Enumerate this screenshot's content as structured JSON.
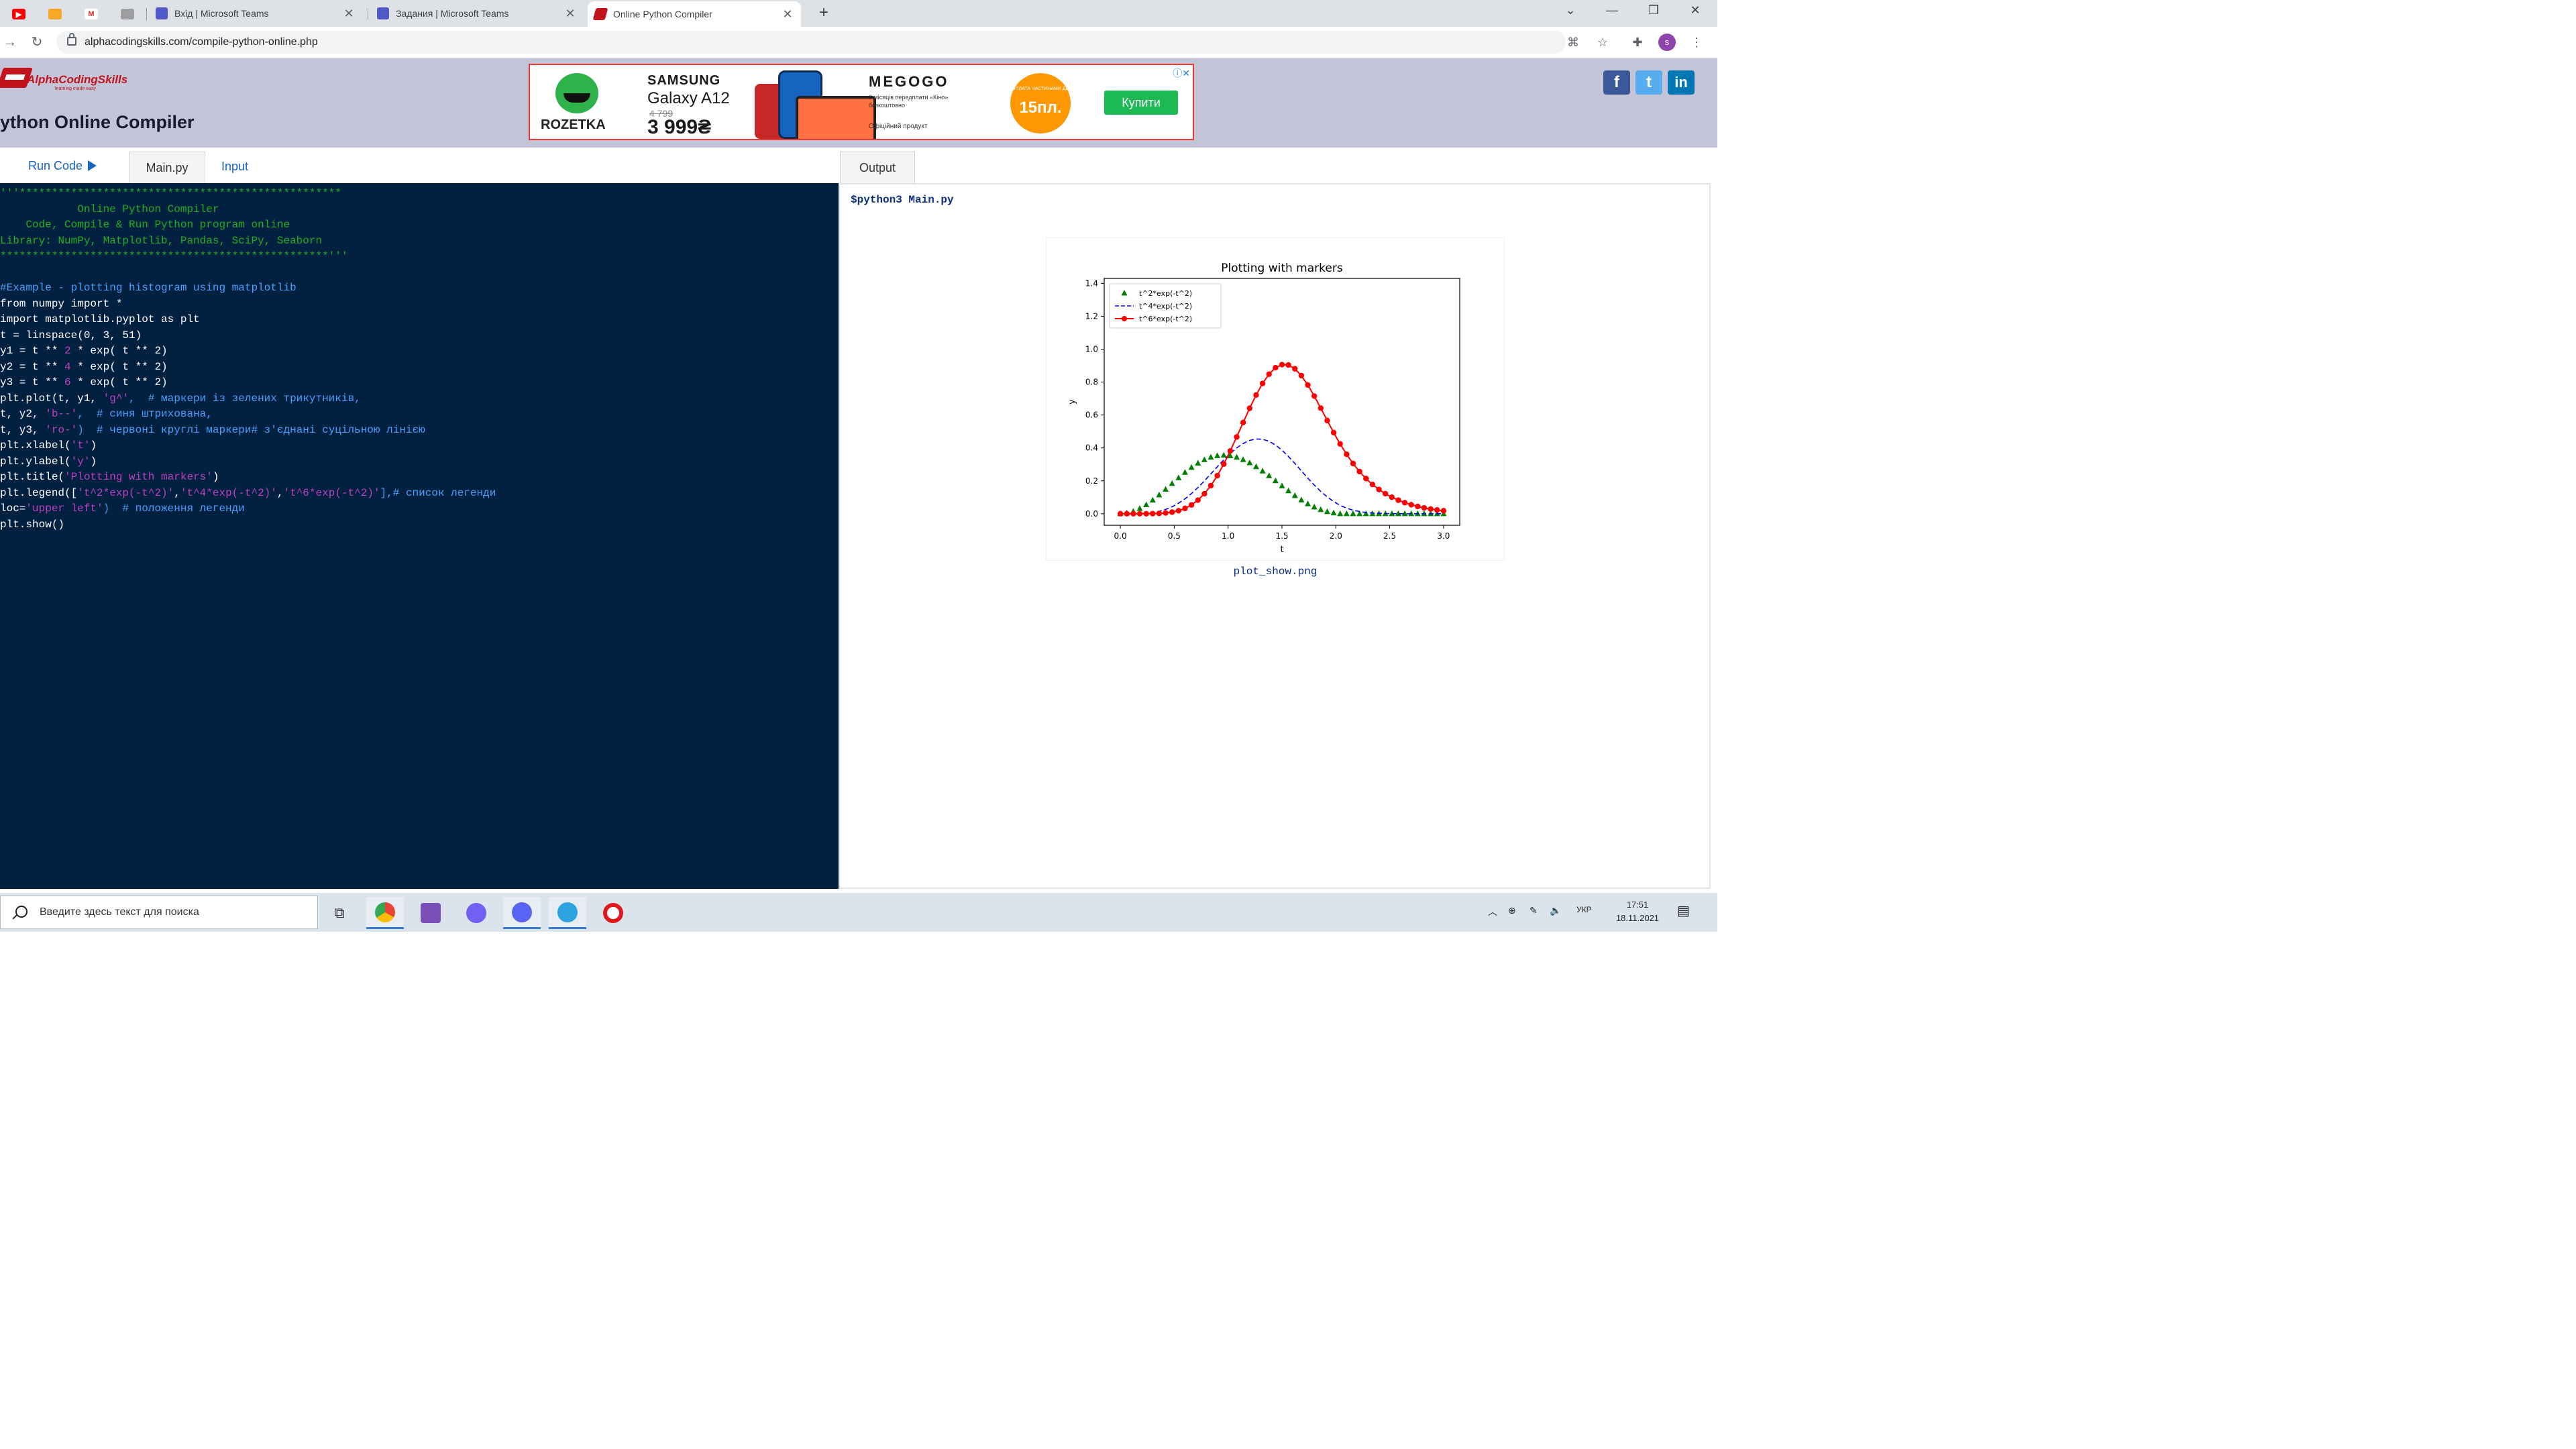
{
  "browser": {
    "tabs": [
      {
        "title": "Вхід | Microsoft Teams"
      },
      {
        "title": "Задания | Microsoft Teams"
      },
      {
        "title": "Online Python Compiler"
      }
    ],
    "new_tab": "+",
    "url": "alphacodingskills.com/compile-python-online.php",
    "profile_initial": "s",
    "pinned_labels": {
      "gmail": "M"
    }
  },
  "site": {
    "logo_text": "AlphaCodingSkills",
    "logo_sub": "learning made easy",
    "title": "ython Online Compiler",
    "social": {
      "facebook": "f",
      "twitter": "t",
      "linkedin": "in"
    }
  },
  "ad": {
    "rozetka": "ROZETKA",
    "brand": "SAMSUNG",
    "model": "Galaxy A12",
    "old_price": "4 799",
    "price": "3 999₴",
    "service": "MEGOGO",
    "service_desc": "6 місяців передплати «Кіно» безкоштовно",
    "official": "Офіційний продукт",
    "badge_top": "ОПЛАТА ЧАСТИНАМИ ДО",
    "badge_num": "15пл.",
    "buy": "Купити",
    "close": "ⓘ✕"
  },
  "editor": {
    "run_label": "Run Code",
    "tab_main": "Main.py",
    "tab_input": "Input",
    "lines": [
      [
        {
          "t": "'''**************************************************",
          "c": "cm"
        }
      ],
      [
        {
          "t": "            Online Python Compiler",
          "c": "cm"
        }
      ],
      [
        {
          "t": "    Code, Compile & Run Python program online",
          "c": "cm"
        }
      ],
      [
        {
          "t": "Library: NumPy, Matplotlib, Pandas, SciPy, Seaborn",
          "c": "cm"
        }
      ],
      [
        {
          "t": "***************************************************'''",
          "c": "cm"
        }
      ],
      [
        {
          "t": "",
          "c": "pl"
        }
      ],
      [
        {
          "t": "#Example - plotting histogram using matplotlib",
          "c": "fn"
        }
      ],
      [
        {
          "t": "from numpy import *",
          "c": "pl"
        }
      ],
      [
        {
          "t": "import matplotlib.pyplot as plt",
          "c": "pl"
        }
      ],
      [
        {
          "t": "t = linspace(0, 3, 51)",
          "c": "pl"
        }
      ],
      [
        {
          "t": "y1 = t ** ",
          "c": "pl"
        },
        {
          "t": "2",
          "c": "st"
        },
        {
          "t": " * exp( t ** 2)",
          "c": "pl"
        }
      ],
      [
        {
          "t": "y2 = t ** ",
          "c": "pl"
        },
        {
          "t": "4",
          "c": "st"
        },
        {
          "t": " * exp( t ** 2)",
          "c": "pl"
        }
      ],
      [
        {
          "t": "y3 = t ** ",
          "c": "pl"
        },
        {
          "t": "6",
          "c": "st"
        },
        {
          "t": " * exp( t ** 2)",
          "c": "pl"
        }
      ],
      [
        {
          "t": "plt.plot(t, y1, ",
          "c": "pl"
        },
        {
          "t": "'g^'",
          "c": "st"
        },
        {
          "t": ",  # маркери із зелених трикутників,",
          "c": "fn"
        }
      ],
      [
        {
          "t": "t, y2, ",
          "c": "pl"
        },
        {
          "t": "'b--'",
          "c": "st"
        },
        {
          "t": ",  # синя штрихована,",
          "c": "fn"
        }
      ],
      [
        {
          "t": "t, y3, ",
          "c": "pl"
        },
        {
          "t": "'ro-'",
          "c": "st"
        },
        {
          "t": ")  # червоні круглі маркери# з'єднані суцільною лінією",
          "c": "fn"
        }
      ],
      [
        {
          "t": "plt.xlabel(",
          "c": "pl"
        },
        {
          "t": "'t'",
          "c": "st"
        },
        {
          "t": ")",
          "c": "pl"
        }
      ],
      [
        {
          "t": "plt.ylabel(",
          "c": "pl"
        },
        {
          "t": "'y'",
          "c": "st"
        },
        {
          "t": ")",
          "c": "pl"
        }
      ],
      [
        {
          "t": "plt.title(",
          "c": "pl"
        },
        {
          "t": "'Plotting with markers'",
          "c": "st"
        },
        {
          "t": ")",
          "c": "pl"
        }
      ],
      [
        {
          "t": "plt.legend([",
          "c": "pl"
        },
        {
          "t": "'t^2*exp(-t^2)'",
          "c": "st"
        },
        {
          "t": ",",
          "c": "pl"
        },
        {
          "t": "'t^4*exp(-t^2)'",
          "c": "st"
        },
        {
          "t": ",",
          "c": "pl"
        },
        {
          "t": "'t^6*exp(-t^2)'",
          "c": "st"
        },
        {
          "t": "],# список легенди",
          "c": "fn"
        }
      ],
      [
        {
          "t": "loc=",
          "c": "pl"
        },
        {
          "t": "'upper left'",
          "c": "st"
        },
        {
          "t": ")  # положення легенди",
          "c": "fn"
        }
      ],
      [
        {
          "t": "plt.show()",
          "c": "pl"
        }
      ]
    ]
  },
  "output": {
    "tab_label": "Output",
    "command": "$python3 Main.py",
    "image_caption": "plot_show.png"
  },
  "chart_data": {
    "type": "line",
    "title": "Plotting with markers",
    "xlabel": "t",
    "ylabel": "y",
    "xlim": [
      -0.15,
      3.15
    ],
    "ylim": [
      -0.07,
      1.43
    ],
    "xticks": [
      "0.0",
      "0.5",
      "1.0",
      "1.5",
      "2.0",
      "2.5",
      "3.0"
    ],
    "yticks": [
      "0.0",
      "0.2",
      "0.4",
      "0.6",
      "0.8",
      "1.0",
      "1.2",
      "1.4"
    ],
    "legend_position": "upper left",
    "x": [
      0,
      0.06,
      0.12,
      0.18,
      0.24,
      0.3,
      0.36,
      0.42,
      0.48,
      0.54,
      0.6,
      0.66,
      0.72,
      0.78,
      0.84,
      0.9,
      0.96,
      1.02,
      1.08,
      1.14,
      1.2,
      1.26,
      1.32,
      1.38,
      1.44,
      1.5,
      1.56,
      1.62,
      1.68,
      1.74,
      1.8,
      1.86,
      1.92,
      1.98,
      2.04,
      2.1,
      2.16,
      2.22,
      2.28,
      2.34,
      2.4,
      2.46,
      2.52,
      2.58,
      2.64,
      2.7,
      2.76,
      2.82,
      2.88,
      2.94,
      3.0
    ],
    "series": [
      {
        "name": "t^2*exp(-t^2)",
        "color": "#008000",
        "style": "triangle-markers",
        "values": [
          0,
          0.0036,
          0.0142,
          0.0313,
          0.0543,
          0.0822,
          0.1139,
          0.1481,
          0.1833,
          0.2181,
          0.2512,
          0.2812,
          0.3071,
          0.3281,
          0.3434,
          0.3525,
          0.3554,
          0.3521,
          0.343,
          0.3285,
          0.3092,
          0.2858,
          0.2592,
          0.2303,
          0.2,
          0.1692,
          0.1389,
          0.11,
          0.0833,
          0.06,
          0.0404,
          0.0246,
          0.0127,
          0.0045,
          0,
          0,
          0,
          0,
          0,
          0,
          0,
          0,
          0,
          0,
          0,
          0,
          0,
          0,
          0,
          0,
          0
        ]
      },
      {
        "name": "t^4*exp(-t^2)",
        "color": "#0000ff",
        "style": "dashed",
        "values": [
          0,
          0.0,
          0.0002,
          0.001,
          0.0031,
          0.0074,
          0.0148,
          0.0261,
          0.0422,
          0.0636,
          0.0904,
          0.1225,
          0.1592,
          0.1996,
          0.2423,
          0.2855,
          0.3275,
          0.3663,
          0.4001,
          0.427,
          0.4455,
          0.4543,
          0.4527,
          0.4404,
          0.4179,
          0.3865,
          0.3483,
          0.3055,
          0.2608,
          0.2163,
          0.1741,
          0.1355,
          0.1019,
          0.0737,
          0.0512,
          0.0341,
          0.0218,
          0.0134,
          0.0079,
          0.0044,
          0.0024,
          0.0012,
          0.0006,
          0.0003,
          0.0001,
          0.0001,
          0,
          0,
          0,
          0,
          0
        ]
      },
      {
        "name": "t^6*exp(-t^2)",
        "color": "#ff0000",
        "style": "solid-circle-markers",
        "values": [
          0,
          0,
          0,
          0,
          0.0,
          0.0007,
          0.0019,
          0.0046,
          0.0097,
          0.0185,
          0.0325,
          0.0534,
          0.0826,
          0.1214,
          0.1709,
          0.2313,
          0.302,
          0.3815,
          0.4666,
          0.5546,
          0.6408,
          0.7212,
          0.7916,
          0.848,
          0.887,
          0.906,
          0.9037,
          0.8807,
          0.8391,
          0.7824,
          0.715,
          0.6416,
          0.5665,
          0.4931,
          0.4242,
          0.3612,
          0.3051,
          0.256,
          0.2139,
          0.1779,
          0.1475,
          0.1219,
          0.1004,
          0.0823,
          0.0672,
          0.0546,
          0.0442,
          0.0356,
          0.0286,
          0.0228,
          0.0181
        ]
      }
    ]
  },
  "taskbar": {
    "search_placeholder": "Введите здесь текст для поиска",
    "lang": "УКР",
    "time": "17:51",
    "date": "18.11.2021"
  }
}
